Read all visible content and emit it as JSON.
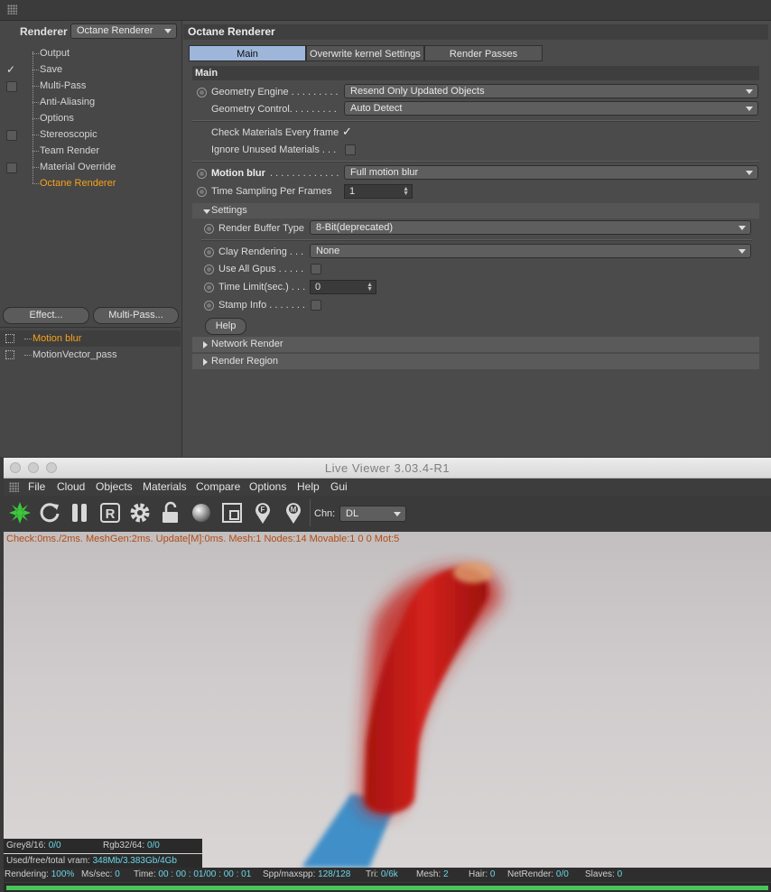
{
  "renderer_panel": {
    "renderer_label": "Renderer",
    "renderer_select": "Octane Renderer",
    "tree": [
      {
        "label": "Output",
        "check": "none"
      },
      {
        "label": "Save",
        "check": "checked"
      },
      {
        "label": "Multi-Pass",
        "check": "box"
      },
      {
        "label": "Anti-Aliasing",
        "check": "none"
      },
      {
        "label": "Options",
        "check": "none"
      },
      {
        "label": "Stereoscopic",
        "check": "box"
      },
      {
        "label": "Team Render",
        "check": "none"
      },
      {
        "label": "Material Override",
        "check": "box"
      },
      {
        "label": "Octane Renderer",
        "check": "none",
        "selected": true
      }
    ],
    "effect_button": "Effect...",
    "multipass_button": "Multi-Pass...",
    "passes": [
      "Motion blur",
      "MotionVector_pass"
    ]
  },
  "octane": {
    "title": "Octane Renderer",
    "tabs": [
      "Main",
      "Overwrite kernel Settings",
      "Render Passes"
    ],
    "main_section": "Main",
    "geometry_engine_label": "Geometry Engine . . . . . . . . .",
    "geometry_engine_value": "Resend Only Updated Objects",
    "geometry_control_label": "Geometry Control. . . . . . . . .",
    "geometry_control_value": "Auto Detect",
    "check_materials_label": "Check Materials Every frame",
    "ignore_unused_label": "Ignore Unused Materials . . .",
    "motion_blur_label": "Motion blur",
    "motion_blur_dots": ". . . . . . . . . . . . .",
    "motion_blur_value": "Full motion blur",
    "time_sampling_label": "Time Sampling Per Frames",
    "time_sampling_value": "1",
    "settings_section": "Settings",
    "render_buffer_label": "Render Buffer Type",
    "render_buffer_value": "8-Bit(deprecated)",
    "clay_label": "Clay Rendering . . .",
    "clay_value": "None",
    "use_all_gpus_label": "Use All Gpus . . . . .",
    "time_limit_label": "Time Limit(sec.) . . .",
    "time_limit_value": "0",
    "stamp_info_label": "Stamp Info . . . . . . .",
    "help_button": "Help",
    "network_render": "Network Render",
    "render_region": "Render Region"
  },
  "live_viewer": {
    "title": "Live Viewer 3.03.4-R1",
    "menu": [
      "File",
      "Cloud",
      "Objects",
      "Materials",
      "Compare",
      "Options",
      "Help",
      "Gui"
    ],
    "toolbar_icons": [
      "octane-logo-icon",
      "refresh-icon",
      "pause-icon",
      "render-r-icon",
      "gear-icon",
      "unlock-icon",
      "sphere-icon",
      "region-icon",
      "focus-pin-icon",
      "material-pin-icon"
    ],
    "channel_label": "Chn:",
    "channel_value": "DL",
    "info_line": "Check:0ms./2ms. MeshGen:2ms. Update[M]:0ms. Mesh:1 Nodes:14 Movable:1  0 0 Mot:5",
    "grey_label": "Grey8/16:",
    "grey_value": "0/0",
    "rgb_label": "Rgb32/64:",
    "rgb_value": "0/0",
    "vram_label": "Used/free/total vram:",
    "vram_value": "348Mb/3.383Gb/4Gb",
    "status": {
      "rendering_label": "Rendering:",
      "rendering_value": "100%",
      "ms_label": "Ms/sec:",
      "ms_value": "0",
      "time_label": "Time:",
      "time_value": "00 : 00 : 01/00 : 00 : 01",
      "spp_label": "Spp/maxspp:",
      "spp_value": "128/128",
      "tri_label": "Tri:",
      "tri_value": "0/6k",
      "mesh_label": "Mesh:",
      "mesh_value": "2",
      "hair_label": "Hair:",
      "hair_value": "0",
      "net_label": "NetRender:",
      "net_value": "0/0",
      "slaves_label": "Slaves:",
      "slaves_value": "0"
    },
    "progress_fraction": 1.0
  },
  "colors": {
    "selected_orange": "#f7a21b",
    "active_tab": "#9db6da",
    "status_value": "#6dd6e6",
    "info_text": "#b24b12",
    "progress_green": "#49c45a",
    "object_red": "#d4221c",
    "shadow_blue": "#3f8fc8"
  }
}
